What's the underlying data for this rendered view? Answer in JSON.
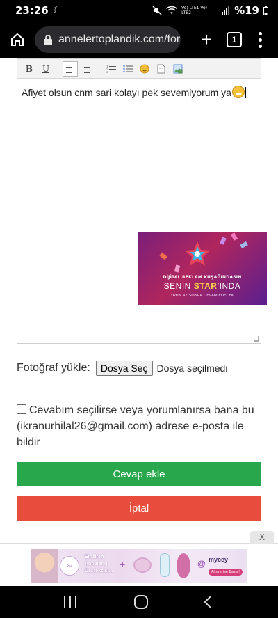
{
  "status_bar": {
    "time": "23:26",
    "moon": "☾",
    "network_text": "Vo) LTE1 Vo) LTE2",
    "battery": "%19"
  },
  "browser": {
    "url": "annelertoplandik.com/foru",
    "tab_count": "1"
  },
  "editor": {
    "text_before": "Afiyet olsun cnm sari ",
    "text_underlined": "kolayı",
    "text_after": " pek sevemiyorum ya"
  },
  "inline_ad": {
    "line1": "DİJİTAL REKLAM KUŞAĞINDASIN",
    "line2_a": "SENİN ",
    "line2_b": "STAR",
    "line2_c": "’INDA",
    "line3": "YAYIN AZ SONRA DEVAM EDECEK"
  },
  "upload": {
    "label": "Fotoğraf yükle:",
    "button": "Dosya Seç",
    "status": "Dosya seçilmedi"
  },
  "notify": {
    "text": "Cevabım seçilirse veya yorumlanırsa bana bu (ikranurhilal26@gmail.com) adrese e-posta ile bildir"
  },
  "actions": {
    "submit": "Cevap ekle",
    "cancel": "İptal"
  },
  "bottom_ad": {
    "close": "X",
    "badge": "Ozel Annelere",
    "text_line1": "Emziren",
    "text_line2": "Annelerin",
    "text_line3": "Destekçisi...",
    "brand": "mycey",
    "cta": "Alışverişe Başla!"
  },
  "colors": {
    "submit": "#28a74d",
    "cancel": "#e74c3c"
  }
}
